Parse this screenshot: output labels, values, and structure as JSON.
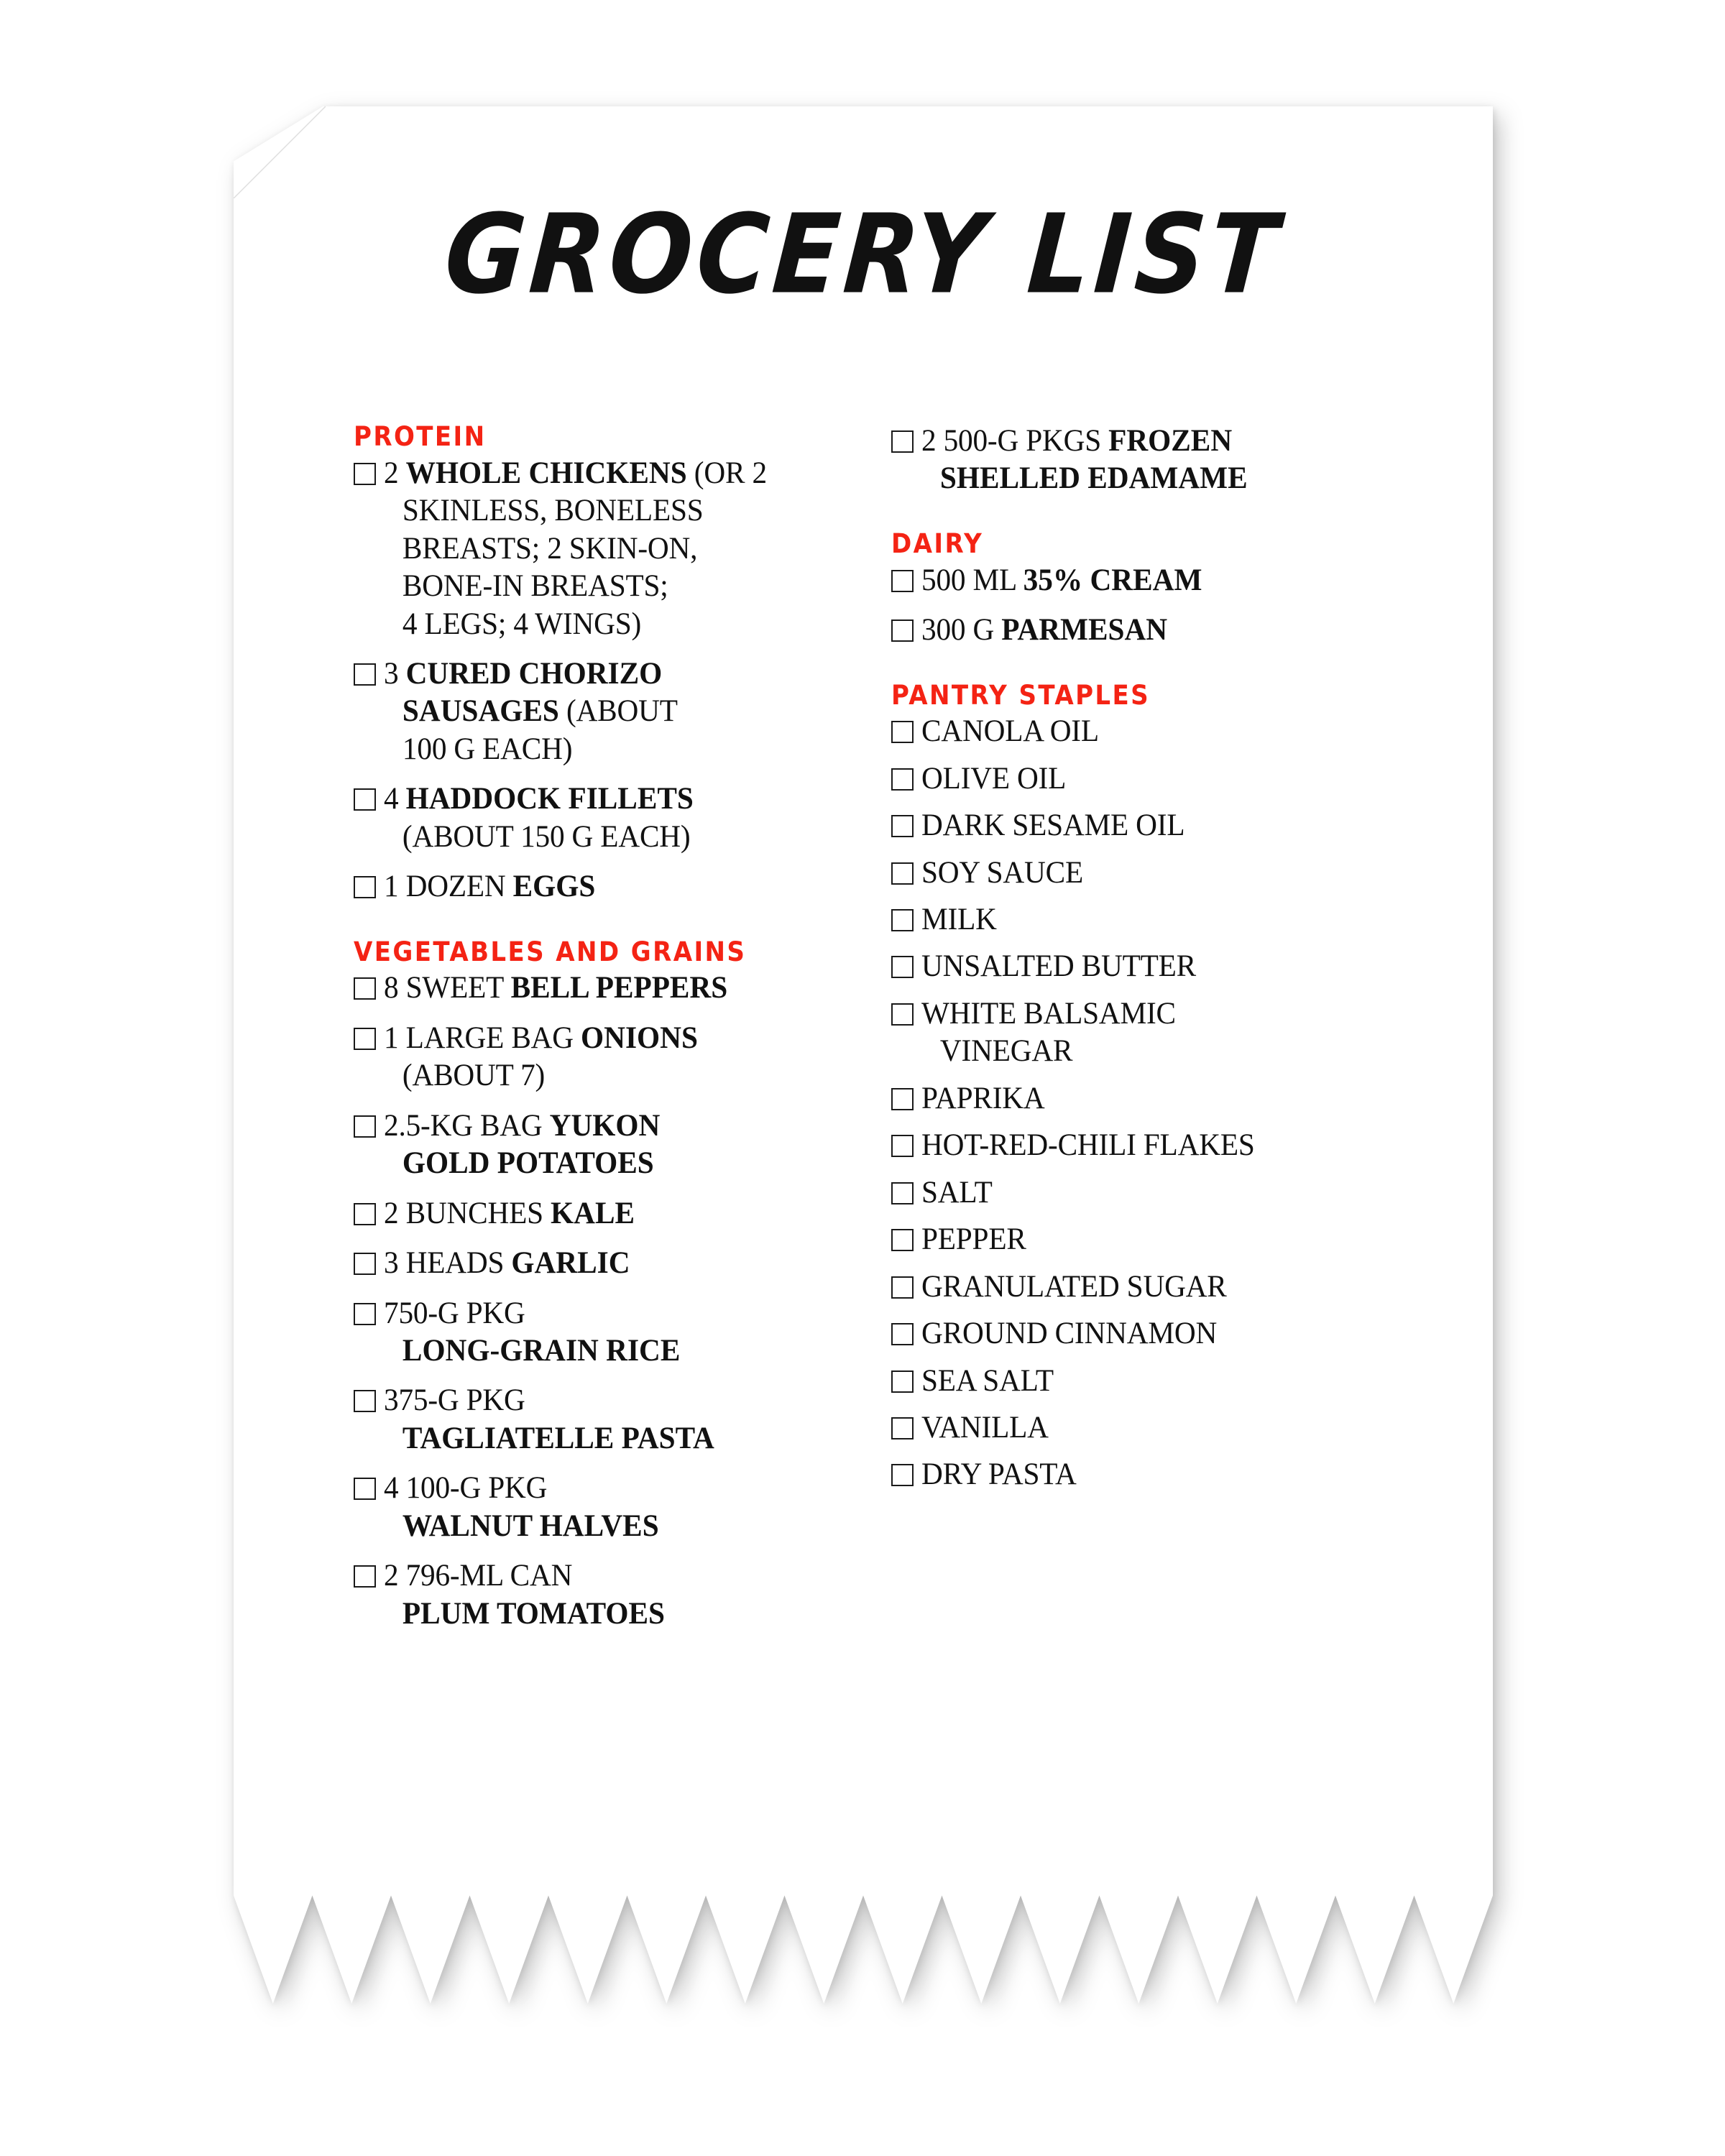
{
  "title": "GROCERY LIST",
  "accent_color": "#F42314",
  "text_color": "#111111",
  "paper_color": "#FFFFFF",
  "checkbox_glyph": "empty-square",
  "columns": {
    "left": [
      {
        "heading": "PROTEIN",
        "items": [
          {
            "lines": [
              {
                "text": "2 ",
                "bold": "WHOLE CHICKENS",
                "after": " (OR 2",
                "indent": false
              },
              {
                "text": "SKINLESS, BONELESS",
                "indent": true
              },
              {
                "text": "BREASTS; 2 SKIN-ON,",
                "indent": true
              },
              {
                "text": "BONE-IN BREASTS;",
                "indent": true
              },
              {
                "text": "4 LEGS; 4 WINGS)",
                "indent": true
              }
            ],
            "full": "2 WHOLE CHICKENS (OR 2 SKINLESS, BONELESS BREASTS; 2 SKIN-ON, BONE-IN BREASTS; 4 LEGS; 4 WINGS)"
          },
          {
            "lines": [
              {
                "text": "3 ",
                "bold": "CURED CHORIZO",
                "indent": false
              },
              {
                "bold": "SAUSAGES",
                "after": " (ABOUT",
                "indent": true
              },
              {
                "text": "100 G EACH)",
                "indent": true
              }
            ],
            "full": "3 CURED CHORIZO SAUSAGES (ABOUT 100 G EACH)"
          },
          {
            "lines": [
              {
                "text": "4 ",
                "bold": "HADDOCK FILLETS",
                "indent": false
              },
              {
                "text": "(ABOUT 150 G EACH)",
                "indent": true
              }
            ],
            "full": "4 HADDOCK FILLETS (ABOUT 150 G EACH)"
          },
          {
            "lines": [
              {
                "text": "1 DOZEN ",
                "bold": "EGGS",
                "indent": false
              }
            ],
            "full": "1 DOZEN EGGS"
          }
        ]
      },
      {
        "heading": "VEGETABLES AND GRAINS",
        "items": [
          {
            "lines": [
              {
                "text": "8 SWEET ",
                "bold": "BELL PEPPERS",
                "indent": false
              }
            ],
            "full": "8 SWEET BELL PEPPERS"
          },
          {
            "lines": [
              {
                "text": "1 LARGE BAG ",
                "bold": "ONIONS",
                "indent": false
              },
              {
                "text": "(ABOUT 7)",
                "indent": true
              }
            ],
            "full": "1 LARGE BAG ONIONS (ABOUT 7)"
          },
          {
            "lines": [
              {
                "text": "2.5-KG BAG ",
                "bold": "YUKON",
                "indent": false
              },
              {
                "bold": "GOLD POTATOES",
                "indent": true
              }
            ],
            "full": "2.5-KG BAG YUKON GOLD POTATOES"
          },
          {
            "lines": [
              {
                "text": "2 BUNCHES ",
                "bold": "KALE",
                "indent": false
              }
            ],
            "full": "2 BUNCHES KALE"
          },
          {
            "lines": [
              {
                "text": "3 HEADS ",
                "bold": "GARLIC",
                "indent": false
              }
            ],
            "full": "3 HEADS GARLIC"
          },
          {
            "lines": [
              {
                "text": "750-G PKG",
                "indent": false
              },
              {
                "bold": "LONG-GRAIN RICE",
                "indent": true
              }
            ],
            "full": "750-G PKG LONG-GRAIN RICE"
          },
          {
            "lines": [
              {
                "text": "375-G PKG",
                "indent": false
              },
              {
                "bold": "TAGLIATELLE PASTA",
                "indent": true
              }
            ],
            "full": "375-G PKG TAGLIATELLE PASTA"
          },
          {
            "lines": [
              {
                "text": "4 100-G PKG",
                "indent": false
              },
              {
                "bold": "WALNUT HALVES",
                "indent": true
              }
            ],
            "full": "4 100-G PKG WALNUT HALVES"
          },
          {
            "lines": [
              {
                "text": "2 796-ML CAN",
                "indent": false
              },
              {
                "bold": "PLUM TOMATOES",
                "indent": true
              }
            ],
            "full": "2 796-ML CAN PLUM TOMATOES"
          }
        ]
      }
    ],
    "right": [
      {
        "heading": null,
        "items": [
          {
            "lines": [
              {
                "text": "2 500-G PKGS ",
                "bold": "FROZEN",
                "indent": false
              },
              {
                "bold": "SHELLED EDAMAME",
                "indent": true
              }
            ],
            "full": "2 500-G PKGS FROZEN SHELLED EDAMAME"
          }
        ]
      },
      {
        "heading": "DAIRY",
        "items": [
          {
            "lines": [
              {
                "text": "500 ML ",
                "bold": "35% CREAM",
                "indent": false
              }
            ],
            "full": "500 ML 35% CREAM"
          },
          {
            "lines": [
              {
                "text": "300 G ",
                "bold": "PARMESAN",
                "indent": false
              }
            ],
            "full": "300 G PARMESAN"
          }
        ]
      },
      {
        "heading": "PANTRY STAPLES",
        "pantry": true,
        "items": [
          {
            "lines": [
              {
                "text": "CANOLA OIL",
                "indent": false
              }
            ],
            "full": "CANOLA OIL"
          },
          {
            "lines": [
              {
                "text": "OLIVE OIL",
                "indent": false
              }
            ],
            "full": "OLIVE OIL"
          },
          {
            "lines": [
              {
                "text": "DARK SESAME OIL",
                "indent": false
              }
            ],
            "full": "DARK SESAME OIL"
          },
          {
            "lines": [
              {
                "text": "SOY SAUCE",
                "indent": false
              }
            ],
            "full": "SOY SAUCE"
          },
          {
            "lines": [
              {
                "text": "MILK",
                "indent": false
              }
            ],
            "full": "MILK"
          },
          {
            "lines": [
              {
                "text": "UNSALTED BUTTER",
                "indent": false
              }
            ],
            "full": "UNSALTED BUTTER"
          },
          {
            "lines": [
              {
                "text": "WHITE BALSAMIC",
                "indent": false
              },
              {
                "text": "VINEGAR",
                "indent": true
              }
            ],
            "full": "WHITE BALSAMIC VINEGAR"
          },
          {
            "lines": [
              {
                "text": "PAPRIKA",
                "indent": false
              }
            ],
            "full": "PAPRIKA"
          },
          {
            "lines": [
              {
                "text": "HOT-RED-CHILI FLAKES",
                "indent": false
              }
            ],
            "full": "HOT-RED-CHILI FLAKES"
          },
          {
            "lines": [
              {
                "text": "SALT",
                "indent": false
              }
            ],
            "full": "SALT"
          },
          {
            "lines": [
              {
                "text": "PEPPER",
                "indent": false
              }
            ],
            "full": "PEPPER"
          },
          {
            "lines": [
              {
                "text": "GRANULATED SUGAR",
                "indent": false
              }
            ],
            "full": "GRANULATED SUGAR"
          },
          {
            "lines": [
              {
                "text": "GROUND CINNAMON",
                "indent": false
              }
            ],
            "full": "GROUND CINNAMON"
          },
          {
            "lines": [
              {
                "text": "SEA SALT",
                "indent": false
              }
            ],
            "full": "SEA SALT"
          },
          {
            "lines": [
              {
                "text": "VANILLA",
                "indent": false
              }
            ],
            "full": "VANILLA"
          },
          {
            "lines": [
              {
                "text": "DRY PASTA",
                "indent": false
              }
            ],
            "full": "DRY PASTA"
          }
        ]
      }
    ]
  }
}
